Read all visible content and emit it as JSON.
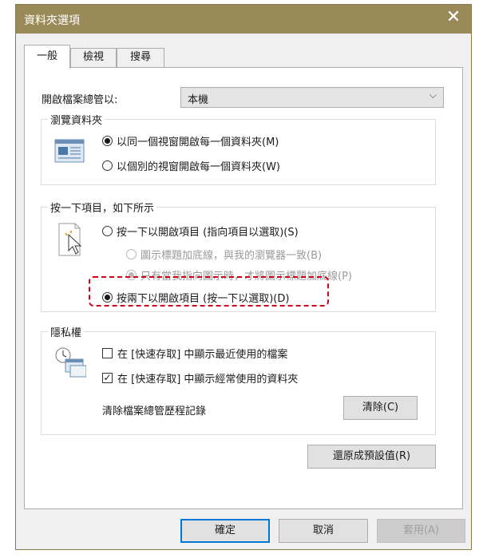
{
  "window": {
    "title": "資料夾選項",
    "close_glyph": "✕"
  },
  "tabs": [
    {
      "label": "一般"
    },
    {
      "label": "檢視"
    },
    {
      "label": "搜尋"
    }
  ],
  "open_explorer": {
    "label": "開啟檔案總管以:",
    "value": "本機"
  },
  "browse": {
    "legend": "瀏覽資料夾",
    "option_same": "以同一個視窗開啟每一個資料夾(M)",
    "option_separate": "以個別的視窗開啟每一個資料夾(W)"
  },
  "click": {
    "legend": "按一下項目，如下所示",
    "option_single": "按一下以開啟項目 (指向項目以選取)(S)",
    "sub_browser": "圖示標題加底線，與我的瀏覽器一致(B)",
    "sub_point": "只有當我指向圖示時，才將圖示標題加底線(P)",
    "option_double": "按兩下以開啟項目 (按一下以選取)(D)"
  },
  "privacy": {
    "legend": "隱私權",
    "recent_files": "在 [快速存取] 中顯示最近使用的檔案",
    "frequent_folders": "在 [快速存取] 中顯示經常使用的資料夾",
    "clear_label": "清除檔案總管歷程記錄",
    "clear_button": "清除(C)"
  },
  "restore_button": "還原成預設值(R)",
  "footer": {
    "ok": "確定",
    "cancel": "取消",
    "apply": "套用(A)"
  },
  "highlight_color": "#d0021b",
  "title_bar_color": "#9a8a5a"
}
